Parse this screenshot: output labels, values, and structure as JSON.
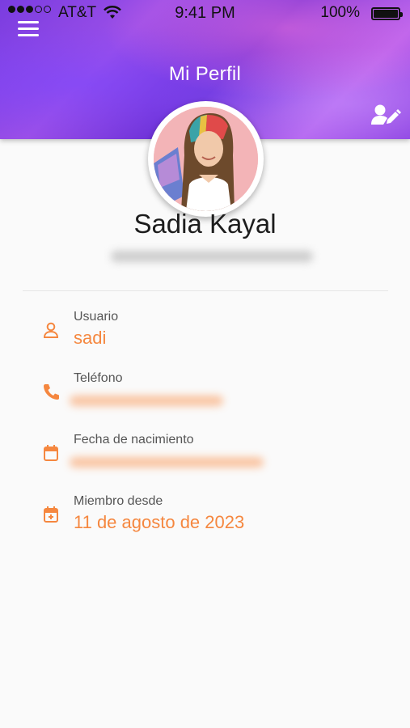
{
  "status_bar": {
    "carrier": "AT&T",
    "time": "9:41 PM",
    "battery": "100%"
  },
  "header": {
    "title": "Mi Perfil",
    "menu_icon": "hamburger-menu-icon",
    "edit_icon": "edit-profile-icon"
  },
  "profile": {
    "name": "Sadia Kayal"
  },
  "fields": {
    "usuario": {
      "label": "Usuario",
      "value": "sadi"
    },
    "telefono": {
      "label": "Teléfono",
      "value": ""
    },
    "nacimiento": {
      "label": "Fecha de nacimiento",
      "value": ""
    },
    "miembro": {
      "label": "Miembro desde",
      "value": "11 de agosto de 2023"
    }
  },
  "colors": {
    "accent": "#f5873f",
    "header": "#8a3fe0"
  }
}
